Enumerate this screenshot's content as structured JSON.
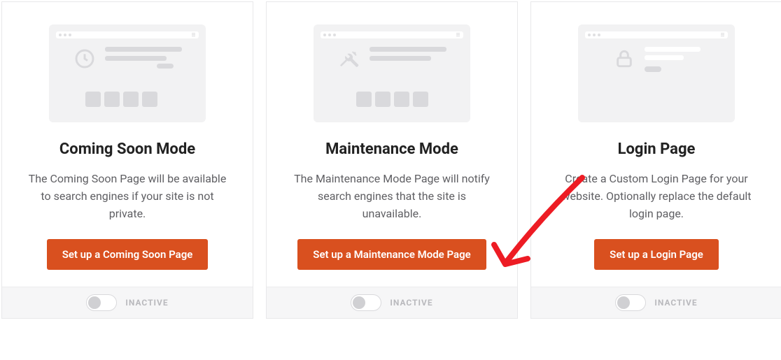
{
  "cards": [
    {
      "key": "coming-soon",
      "title": "Coming Soon Mode",
      "description": "The Coming Soon Page will be available to search engines if your site is not private.",
      "button_label": "Set up a Coming Soon Page",
      "status_label": "INACTIVE",
      "active": false,
      "icon": "clock-icon"
    },
    {
      "key": "maintenance",
      "title": "Maintenance Mode",
      "description": "The Maintenance Mode Page will notify search engines that the site is unavailable.",
      "button_label": "Set up a Maintenance Mode Page",
      "status_label": "INACTIVE",
      "active": false,
      "icon": "tools-icon"
    },
    {
      "key": "login",
      "title": "Login Page",
      "description": "Create a Custom Login Page for your website. Optionally replace the default login page.",
      "button_label": "Set up a Login Page",
      "status_label": "INACTIVE",
      "active": false,
      "icon": "lock-icon"
    }
  ],
  "annotation": {
    "arrow_target": "maintenance-setup-button",
    "color": "#ed1c24"
  }
}
